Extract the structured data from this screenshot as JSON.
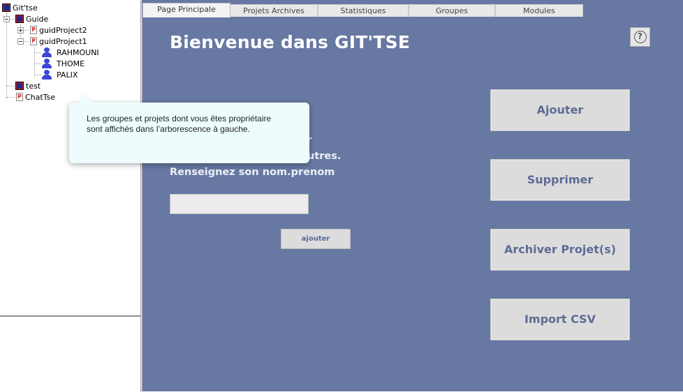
{
  "tree": {
    "root": "Git'tse",
    "group_guide": "Guide",
    "project_2": "guidProject2",
    "project_1": "guidProject1",
    "users": [
      "RAHMOUNI",
      "THOME",
      "PALIX"
    ],
    "group_test": "test",
    "project_chat": "ChatTse",
    "project_icon_letter": "P"
  },
  "tabs": [
    "Page Principale",
    "Projets Archives",
    "Statistiques",
    "Groupes",
    "Modules"
  ],
  "main": {
    "title": "Bienvenue dans GIT'TSE",
    "help_glyph": "?",
    "instruction_line1": "ur",
    "instruction_line2": "utres.",
    "instruction_line3": "Renseignez son nom.prenom",
    "name_value": "",
    "add_small_label": "ajouter",
    "buttons": {
      "add": "Ajouter",
      "remove": "Supprimer",
      "archive": "Archiver Projet(s)",
      "import": "Import CSV"
    }
  },
  "tooltip": {
    "line1": "Les groupes et projets dont vous êtes propriétaire",
    "line2": "sont affichés dans l’arborescence à gauche."
  },
  "colors": {
    "main_bg": "#6778a3",
    "group_icon": "#cc2222",
    "user_icon": "#3a46d6",
    "tooltip_bg": "#eefcfd"
  }
}
